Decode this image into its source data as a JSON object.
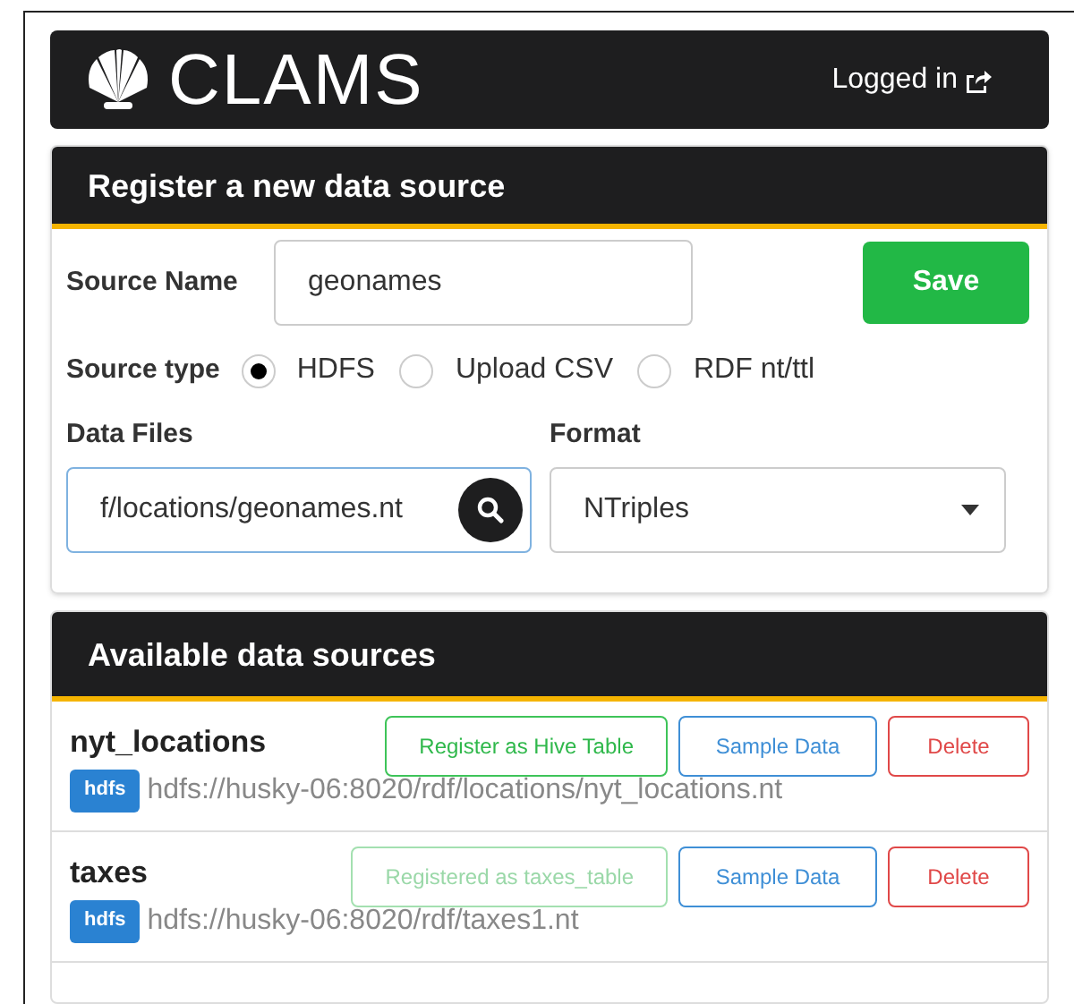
{
  "header": {
    "logo_text": "CLAMS",
    "login": "Logged in"
  },
  "register": {
    "title": "Register a new data source",
    "source_name": {
      "label": "Source Name",
      "value": "geonames"
    },
    "save": "Save",
    "source_type": {
      "label": "Source type",
      "options": [
        {
          "label": "HDFS",
          "selected": true
        },
        {
          "label": "Upload CSV",
          "selected": false
        },
        {
          "label": "RDF nt/ttl",
          "selected": false
        }
      ]
    },
    "data_files": {
      "label": "Data Files",
      "value": "f/locations/geonames.nt"
    },
    "format": {
      "label": "Format",
      "value": "NTriples"
    }
  },
  "available": {
    "title": "Available data sources",
    "sources": [
      {
        "name": "nyt_locations",
        "register": "Register as Hive Table",
        "registered": false,
        "sample": "Sample Data",
        "delete": "Delete",
        "badge": "hdfs",
        "path": "hdfs://husky-06:8020/rdf/locations/nyt_locations.nt"
      },
      {
        "name": "taxes",
        "register": "Registered as taxes_table",
        "registered": true,
        "sample": "Sample Data",
        "delete": "Delete",
        "badge": "hdfs",
        "path": "hdfs://husky-06:8020/rdf/taxes1.nt"
      }
    ]
  }
}
